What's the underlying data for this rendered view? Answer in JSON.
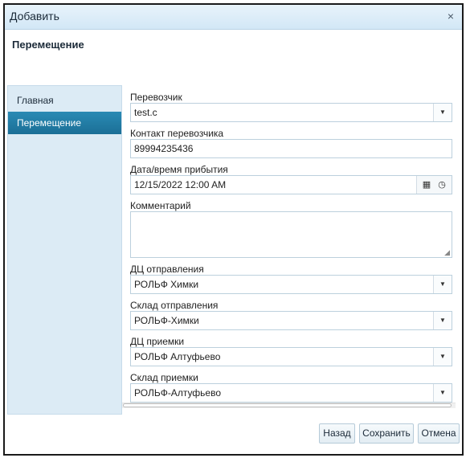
{
  "dialog": {
    "title": "Добавить",
    "close_symbol": "×",
    "heading": "Перемещение"
  },
  "sidebar": {
    "items": [
      {
        "label": "Главная",
        "active": false
      },
      {
        "label": "Перемещение",
        "active": true
      }
    ]
  },
  "form": {
    "carrier": {
      "label": "Перевозчик",
      "value": "test.c"
    },
    "carrier_contact": {
      "label": "Контакт перевозчика",
      "value": "89994235436"
    },
    "arrival": {
      "label": "Дата/время прибытия",
      "value": "12/15/2022 12:00 AM"
    },
    "comment": {
      "label": "Комментарий",
      "value": ""
    },
    "dc_from": {
      "label": "ДЦ отправления",
      "value": "РОЛЬФ Химки"
    },
    "warehouse_from": {
      "label": "Склад отправления",
      "value": "РОЛЬФ-Химки"
    },
    "dc_to": {
      "label": "ДЦ приемки",
      "value": "РОЛЬФ Алтуфьево"
    },
    "warehouse_to": {
      "label": "Склад приемки",
      "value": "РОЛЬФ-Алтуфьево"
    }
  },
  "buttons": {
    "back": "Назад",
    "save": "Сохранить",
    "cancel": "Отмена"
  },
  "icons": {
    "dropdown": "chevron-down-icon",
    "calendar": "calendar-icon",
    "clock": "clock-icon",
    "close": "close-icon",
    "resize": "resize-grip-icon"
  },
  "colors": {
    "titlebar": "#d2e7f6",
    "sidebar": "#dcebf5",
    "active_item": "#1b6f96"
  }
}
